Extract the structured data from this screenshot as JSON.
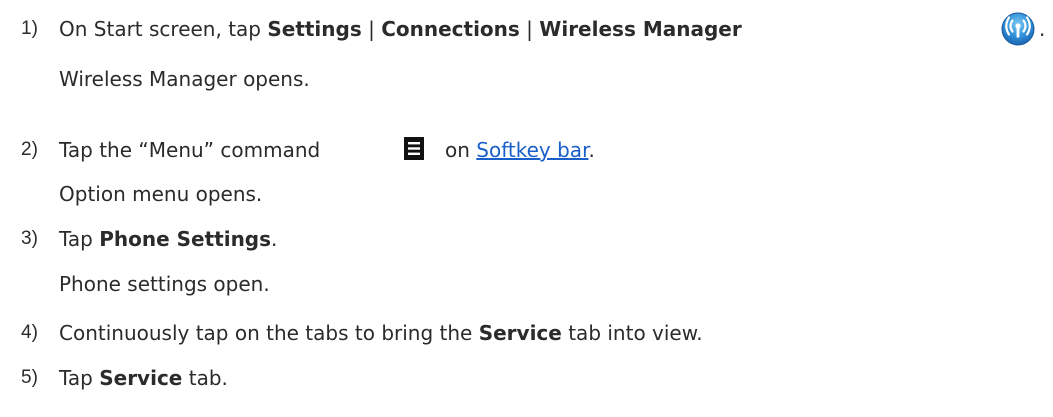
{
  "steps": [
    {
      "num": "1)",
      "parts": {
        "a": "On Start screen, tap ",
        "b1": "Settings",
        "sep1": " | ",
        "b2": "Connections",
        "sep2": " | ",
        "b3": "Wireless Manager",
        "end": "."
      },
      "result": "Wireless Manager opens."
    },
    {
      "num": "2)",
      "parts": {
        "a": "Tap the “Menu” command",
        "on": "on ",
        "link": "Softkey bar",
        "end": "."
      },
      "result": "Option menu opens."
    },
    {
      "num": "3)",
      "parts": {
        "a": "Tap ",
        "b": "Phone Settings",
        "end": "."
      },
      "result": "Phone settings open."
    },
    {
      "num": "4)",
      "parts": {
        "a": "Continuously tap on the tabs to bring the ",
        "b": "Service",
        "end": " tab into view."
      }
    },
    {
      "num": "5)",
      "parts": {
        "a": "Tap ",
        "b": "Service",
        "end": " tab."
      }
    }
  ],
  "icons": {
    "wireless_manager": "wireless-manager-icon",
    "menu": "menu-icon"
  },
  "colors": {
    "text": "#2b2b2b",
    "link": "#1a5fc9",
    "icon_blue": "#2f8fd8"
  }
}
